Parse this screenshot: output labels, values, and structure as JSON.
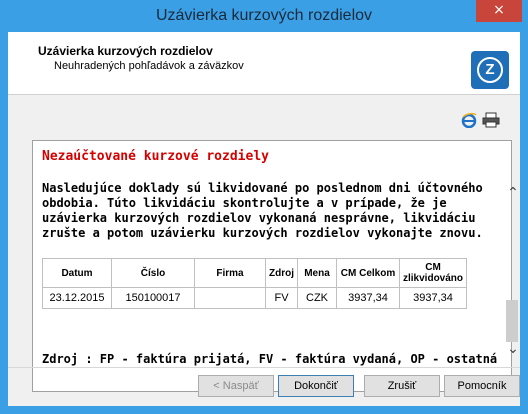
{
  "window": {
    "title": "Uzávierka kurzových rozdielov",
    "close_label": "×"
  },
  "header": {
    "title": "Uzávierka kurzových rozdielov",
    "subtitle": "Neuhradených pohľadávok a záväzkov",
    "logo_letter": "Z"
  },
  "report": {
    "heading": "Nezaúčtované kurzové rozdiely",
    "paragraph": "Nasledujúce doklady sú likvidované po poslednom dni účtovného obdobia. Túto likvidáciu skontrolujte a v prípade, že je uzávierka kurzových rozdielov vykonaná nesprávne, likvidáciu zrušte a potom uzávierku kurzových rozdielov vykonajte znovu.",
    "table": {
      "columns": [
        "Datum",
        "Číslo",
        "Firma",
        "Zdroj",
        "Mena",
        "CM Celkom",
        "CM",
        "zlikvidováno"
      ],
      "rows": [
        [
          "23.12.2015",
          "150100017",
          "",
          "FV",
          "CZK",
          "3937,34",
          "3937,34"
        ]
      ]
    },
    "zdroj_note": "Zdroj : FP - faktúra prijatá, FV - faktúra vydaná, OP - ostatná"
  },
  "buttons": {
    "back": "< Naspäť",
    "finish": "Dokončiť",
    "cancel": "Zrušiť",
    "help": "Pomocník"
  },
  "colors": {
    "titlebar": "#3b9fe6",
    "close": "#c7453a",
    "heading_red": "#d40000"
  }
}
